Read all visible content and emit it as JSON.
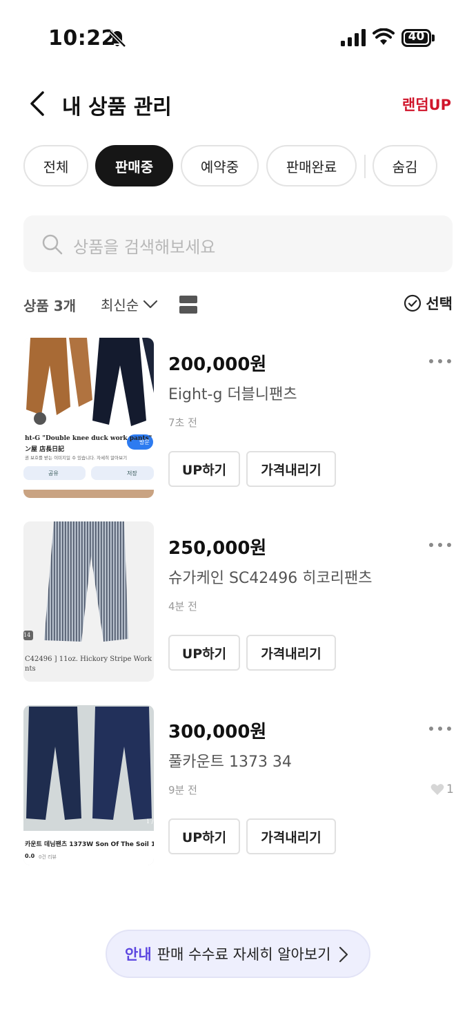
{
  "status_bar": {
    "time": "10:22",
    "battery": "40"
  },
  "header": {
    "title": "내 상품 관리",
    "random_up": "랜덤UP"
  },
  "tabs": [
    {
      "label": "전체",
      "active": false
    },
    {
      "label": "판매중",
      "active": true
    },
    {
      "label": "예약중",
      "active": false
    },
    {
      "label": "판매완료",
      "active": false
    },
    {
      "label": "숨김",
      "active": false
    }
  ],
  "search": {
    "placeholder": "상품을 검색해보세요"
  },
  "toolbar": {
    "count": "상품 3개",
    "sort": "최신순",
    "select": "선택"
  },
  "products": [
    {
      "price": "200,000원",
      "name": "Eight-g 더블니팬츠",
      "time": "7초 전",
      "up_label": "UP하기",
      "price_down_label": "가격내리기",
      "likes": "",
      "thumb_text1": "ht-G \"Double knee duck work pants\" -",
      "thumb_text2": "ン屋 店長日記",
      "thumb_text3": "권 보호를 받는 이미지일 수 있습니다. 자세히 알아보기",
      "thumb_share": "공유",
      "thumb_save": "저장",
      "thumb_visit": "방문"
    },
    {
      "price": "250,000원",
      "name": "슈가케인 SC42496 히코리팬츠",
      "time": "4분 전",
      "up_label": "UP하기",
      "price_down_label": "가격내리기",
      "likes": "",
      "thumb_text1": "C42496 ] 11oz. Hickory Stripe Work",
      "thumb_text2": "nts",
      "thumb_badge": "14"
    },
    {
      "price": "300,000원",
      "name": "풀카운트 1373 34",
      "time": "9분 전",
      "up_label": "UP하기",
      "price_down_label": "가격내리기",
      "likes": "1",
      "thumb_text1": "카운트 데님팬츠 1373W Son Of The Soil 1373W",
      "thumb_text2": "0.0",
      "thumb_text3": "0건 리뷰",
      "thumb_badge": "1 /"
    }
  ],
  "notice": {
    "tag": "안내",
    "text": "판매 수수료 자세히 알아보기"
  },
  "colors": {
    "accent_red": "#d0152b",
    "notice_purple": "#5b45e0",
    "active_tab": "#161616"
  }
}
